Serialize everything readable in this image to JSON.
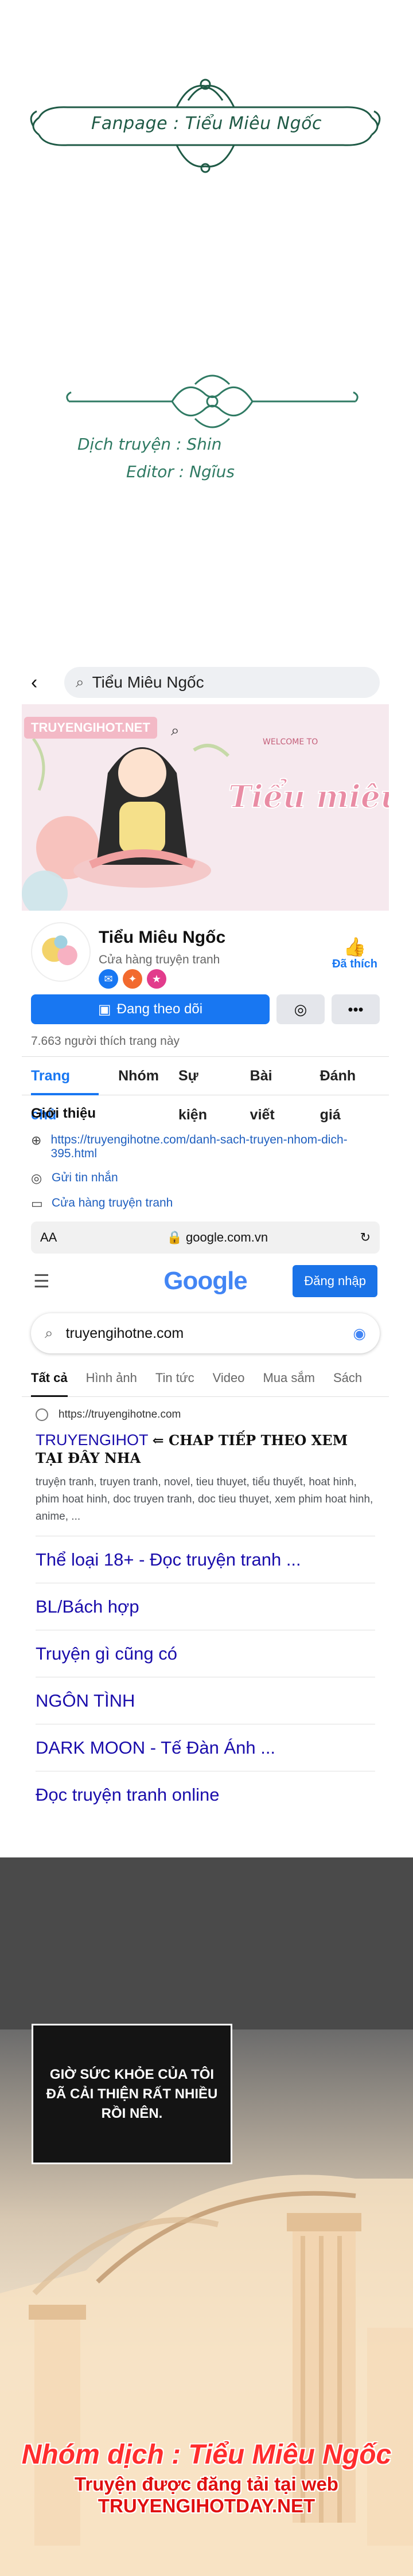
{
  "credits": {
    "fanpage": "Fanpage : Tiểu Miêu Ngốc",
    "translator": "Dịch truyện :  Shin",
    "editor": "Editor :  Ngĩus"
  },
  "facebook": {
    "search_value": "Tiểu Miêu Ngốc",
    "cover_watermark": "TRUYENGIHOT.NET",
    "cover_title": "Tiểu miêu ngốc",
    "cover_welcome": "WELCOME TO",
    "page_name": "Tiểu Miêu Ngốc",
    "page_category": "Cửa hàng truyện tranh",
    "liked_label": "Đã thích",
    "follow_button": "Đang theo dõi",
    "likes_count": "7.663 người thích trang này",
    "tabs": [
      "Trang chủ",
      "Nhóm",
      "Sự kiện",
      "Bài viết",
      "Đánh giá"
    ],
    "intro_heading": "Giới thiệu",
    "intro_link": "https://truyengihotne.com/danh-sach-truyen-nhom-dich-395.html",
    "intro_message": "Gửi tin nhắn",
    "intro_category": "Cửa hàng truyện tranh"
  },
  "browser": {
    "aa": "AA",
    "url": "google.com.vn"
  },
  "google": {
    "logo": "Google",
    "sign_in": "Đăng nhập",
    "query": "truyengihotne.com",
    "tabs": [
      "Tất cả",
      "Hình ảnh",
      "Tin tức",
      "Video",
      "Mua sắm",
      "Sách"
    ],
    "result_url": "https://truyengihotne.com",
    "result_title": "TRUYENGIHOT",
    "result_title_highlight": "⇐ CHAP TIẾP THEO XEM TẠI ĐÂY NHA",
    "result_snippet": "truyện tranh, truyen tranh, novel, tieu thuyet, tiểu thuyết, hoat hinh, phim hoat hinh, doc truyen tranh, doc tieu thuyet, xem phim hoat hinh, anime, ...",
    "sitelinks": [
      "Thể loại 18+ - Đọc truyện tranh ...",
      "BL/Bách hợp",
      "Truyện gì cũng có",
      "NGÔN TÌNH",
      "DARK MOON - Tế Đàn Ánh ...",
      "Đọc truyện tranh online"
    ]
  },
  "scene": {
    "narration": "GIỜ SỨC KHỎE CỦA TÔI ĐÃ CẢI THIỆN RẤT NHIỀU RỒI NÊN.",
    "watermark_group": "Nhóm dịch : Tiểu Miêu Ngốc",
    "watermark_site": "Truyện được đăng tải tại web TRUYENGIHOTDAY.NET"
  },
  "colors": {
    "fb_blue": "#1877f2",
    "google_blue": "#1a73e8",
    "credit_green": "#1f5a46",
    "watermark_red": "#ff2d2d"
  }
}
